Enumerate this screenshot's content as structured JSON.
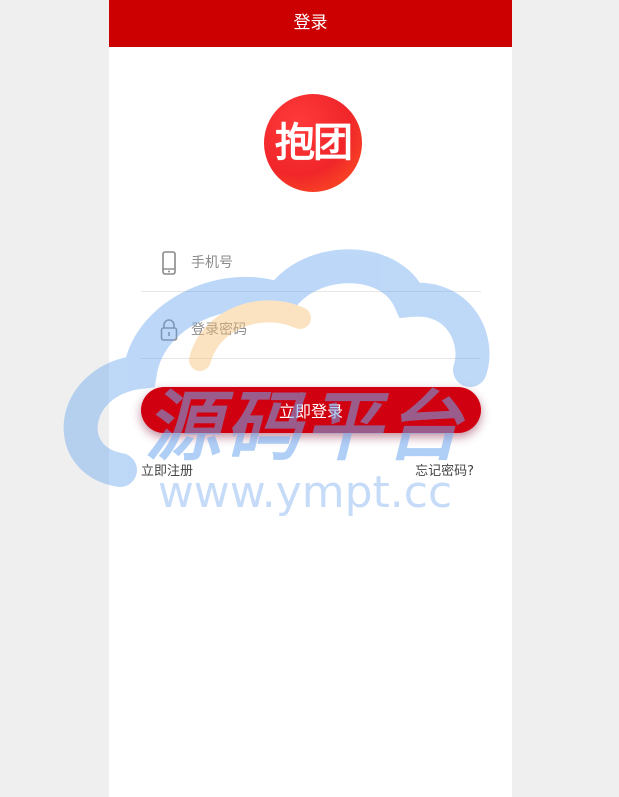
{
  "header": {
    "title": "登录"
  },
  "logo": {
    "text": "抱团",
    "icon": "baotuan-logo"
  },
  "form": {
    "phone": {
      "placeholder": "手机号",
      "value": "",
      "icon": "mobile-phone-icon"
    },
    "password": {
      "placeholder": "登录密码",
      "value": "",
      "icon": "lock-icon"
    },
    "submit_label": "立即登录"
  },
  "links": {
    "register": "立即注册",
    "forgot": "忘记密码?"
  },
  "watermark": {
    "title": "源码平台",
    "url": "www.ympt.cc"
  },
  "colors": {
    "header_bg": "#cc0000",
    "button_bg": "#d00010",
    "logo_bg": "#f0262a",
    "watermark_blue": "#6fa8f0",
    "watermark_orange": "#f7c27a"
  }
}
